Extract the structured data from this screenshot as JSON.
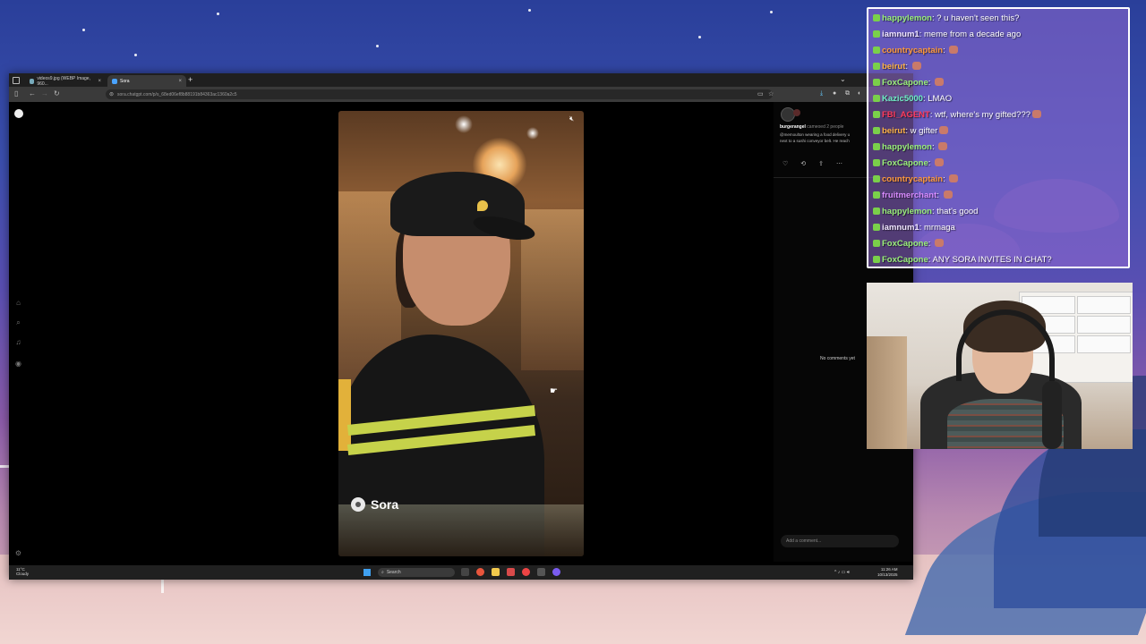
{
  "browser": {
    "tabs": [
      {
        "label": "videos9.jpg (WEBP Image, 960...",
        "active": false
      },
      {
        "label": "Sora",
        "active": true
      }
    ],
    "url": "sora.chatgpt.com/p/s_68ed06ef8b88191b84363ac1360a2c5"
  },
  "sora": {
    "watermark": "Sora",
    "author": "burgerangel",
    "cameo_text": "cameoed 2 people",
    "description_line1": "@memoulton wearing a food delivery u",
    "description_line2": "next to a sushi conveyor belt. He reach",
    "no_comments": "No comments yet",
    "add_comment_placeholder": "Add a comment..."
  },
  "taskbar": {
    "weather_temp": "11°C",
    "weather_desc": "Cloudy",
    "search_label": "Search",
    "time": "11:26 AM",
    "date": "10/13/2025"
  },
  "chat": {
    "messages": [
      {
        "user": "happylemon",
        "text": "? u haven't seen this?",
        "color": "#9af07a"
      },
      {
        "user": "iamnum1",
        "text": "meme from a decade ago",
        "color": "#f0e6ff"
      },
      {
        "user": "countrycaptain",
        "text": "",
        "color": "#ff9a3c"
      },
      {
        "user": "beirut",
        "text": "",
        "color": "#ffb347"
      },
      {
        "user": "FoxCapone",
        "text": "",
        "color": "#9af07a"
      },
      {
        "user": "Kazic5000",
        "text": "LMAO",
        "color": "#6ff0c8"
      },
      {
        "user": "FBI_AGENT",
        "text": "wtf, where's my gifted???",
        "color": "#ff3b5c"
      },
      {
        "user": "beirut",
        "text": "w gifter",
        "color": "#ffb347"
      },
      {
        "user": "happylemon",
        "text": "",
        "color": "#9af07a"
      },
      {
        "user": "FoxCapone",
        "text": "",
        "color": "#9af07a"
      },
      {
        "user": "countrycaptain",
        "text": "",
        "color": "#ff9a3c"
      },
      {
        "user": "fruitmerchant",
        "text": "",
        "color": "#d98cff"
      },
      {
        "user": "happylemon",
        "text": "that's good",
        "color": "#9af07a"
      },
      {
        "user": "iamnum1",
        "text": "mrmaga",
        "color": "#f0e6ff"
      },
      {
        "user": "FoxCapone",
        "text": "",
        "color": "#9af07a"
      },
      {
        "user": "FoxCapone",
        "text": "ANY SORA INVITES IN CHAT?",
        "color": "#9af07a"
      }
    ]
  }
}
